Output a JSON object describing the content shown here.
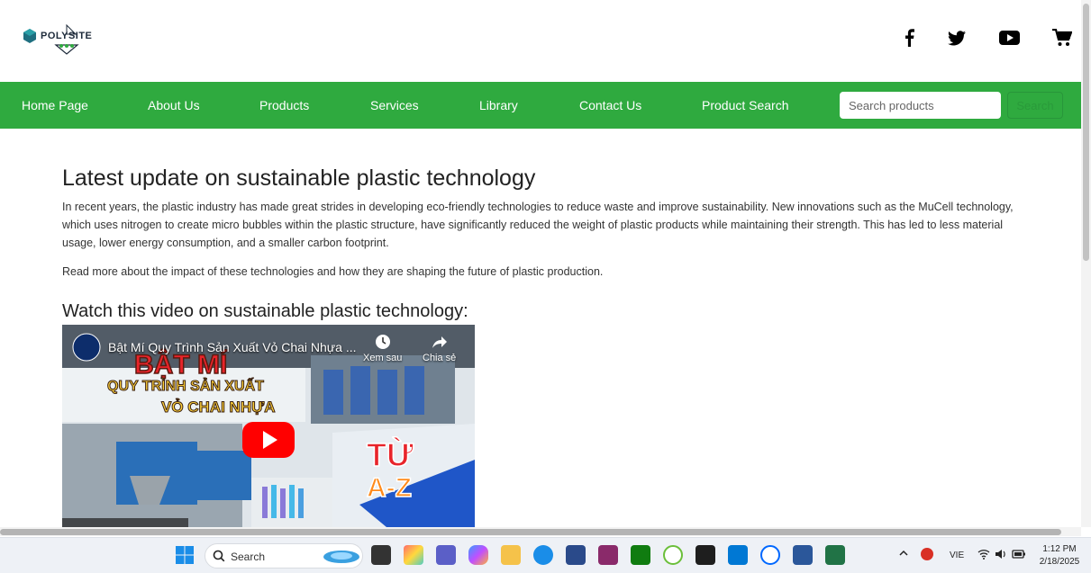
{
  "header": {
    "logo_text": "POLYSITE",
    "social_icons": [
      "facebook-icon",
      "twitter-icon",
      "youtube-icon",
      "cart-icon"
    ]
  },
  "nav": {
    "items": [
      "Home Page",
      "About Us",
      "Products",
      "Services",
      "Library",
      "Contact Us",
      "Product Search"
    ],
    "search_placeholder": "Search products",
    "search_button": "Search",
    "color": "#2faa3f"
  },
  "article": {
    "title": "Latest update on sustainable plastic technology",
    "body": "In recent years, the plastic industry has made great strides in developing eco-friendly technologies to reduce waste and improve sustainability. New innovations such as the MuCell technology, which uses nitrogen to create micro bubbles within the plastic structure, have significantly reduced the weight of plastic products while maintaining their strength. This has led to less material usage, lower energy consumption, and a smaller carbon footprint.",
    "read_more": "Read more about the impact of these technologies and how they are shaping the future of plastic production.",
    "video_heading": "Watch this video on sustainable plastic technology:"
  },
  "video": {
    "title": "Bật Mí Quy Trình Sản Xuất Vỏ Chai Nhựa ...",
    "watch_later": "Xem sau",
    "share": "Chia sẻ",
    "thumb_line1": "BẬT MÍ",
    "thumb_line2": "QUY TRÌNH SẢN XUẤT",
    "thumb_line3": "VỎ CHAI NHỰA",
    "thumb_badge1": "TỪ",
    "thumb_badge2": "A-Z"
  },
  "taskbar": {
    "search_label": "Search",
    "language": "VIE",
    "time": "1:12 PM",
    "date": "2/18/2025"
  }
}
